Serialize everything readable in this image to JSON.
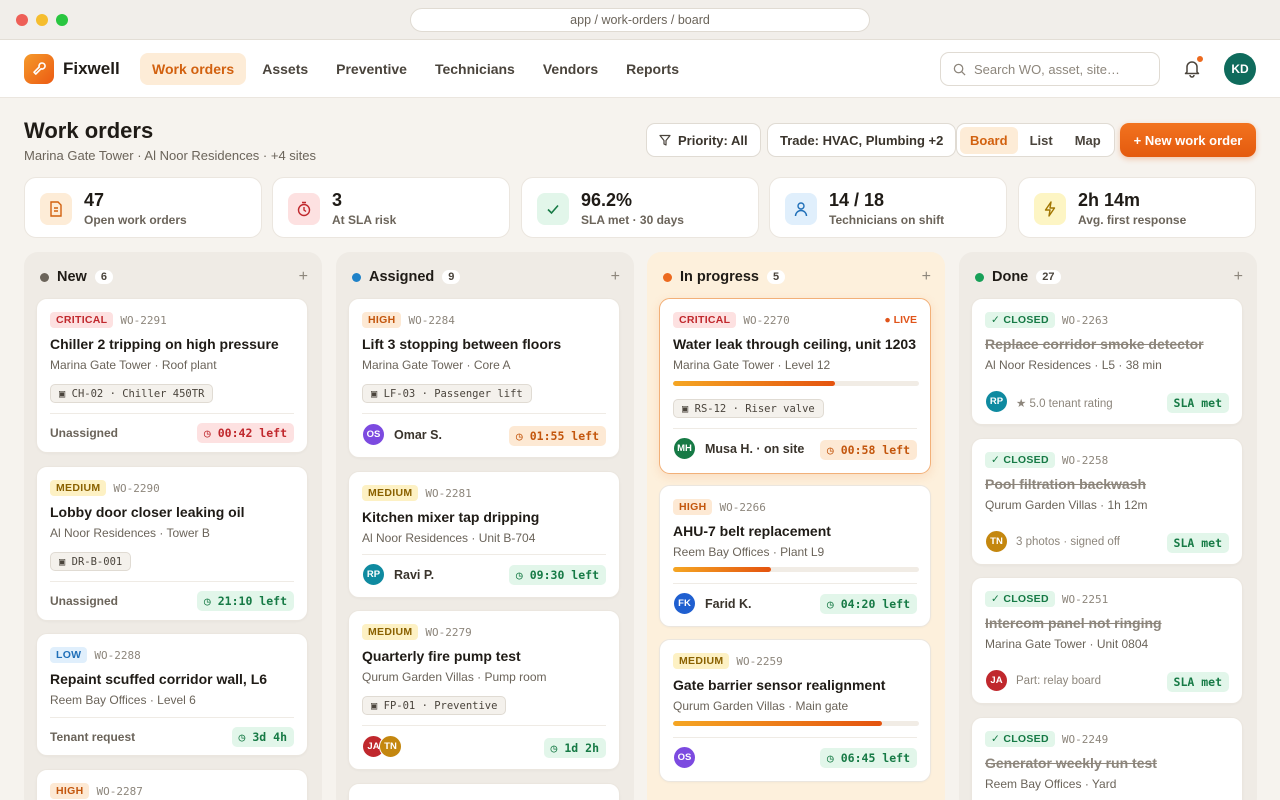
{
  "browser": {
    "url": "app / work-orders / board"
  },
  "app": {
    "brand": "Fixwell",
    "nav": [
      "Work orders",
      "Assets",
      "Preventive",
      "Technicians",
      "Vendors",
      "Reports"
    ],
    "search_placeholder": "Search WO, asset, site…",
    "user_initials": "KD"
  },
  "page": {
    "title": "Work orders",
    "subtitle": "Marina Gate Tower · Al Noor Residences · +4 sites",
    "filter_priority": "Priority: All",
    "filter_trade": "Trade: HVAC, Plumbing +2",
    "views": [
      "Board",
      "List",
      "Map"
    ],
    "active_view": "Board",
    "new_button": "+ New work order"
  },
  "colors": {
    "accent": "#ec6a1f",
    "critical": "#c0282d",
    "success": "#167a45"
  },
  "stats": [
    {
      "value": "47",
      "label": "Open work orders",
      "icon": "document-icon"
    },
    {
      "value": "3",
      "label": "At SLA risk",
      "icon": "stopwatch-icon"
    },
    {
      "value": "96.2%",
      "label": "SLA met · 30 days",
      "icon": "check-icon"
    },
    {
      "value": "14 / 18",
      "label": "Technicians on shift",
      "icon": "person-icon"
    },
    {
      "value": "2h 14m",
      "label": "Avg. first response",
      "icon": "lightning-icon"
    }
  ],
  "columns": [
    {
      "title": "New",
      "count": "6",
      "cards": [
        {
          "priority": "CRITICAL",
          "wo": "WO-2291",
          "title": "Chiller 2 tripping on high pressure",
          "location": "Marina Gate Tower · Roof plant",
          "asset": "▣ CH-02 · Chiller 450TR",
          "assignee": "Unassigned",
          "sla": "◷ 00:42 left"
        },
        {
          "priority": "MEDIUM",
          "wo": "WO-2290",
          "title": "Lobby door closer leaking oil",
          "location": "Al Noor Residences · Tower B",
          "asset": "▣ DR-B-001",
          "assignee": "Unassigned",
          "sla": "◷ 21:10 left"
        },
        {
          "priority": "LOW",
          "wo": "WO-2288",
          "title": "Repaint scuffed corridor wall, L6",
          "location": "Reem Bay Offices · Level 6",
          "assignee": "Tenant request",
          "sla": "◷ 3d 4h"
        },
        {
          "priority": "HIGH",
          "wo": "WO-2287"
        }
      ]
    },
    {
      "title": "Assigned",
      "count": "9",
      "cards": [
        {
          "priority": "HIGH",
          "wo": "WO-2284",
          "title": "Lift 3 stopping between floors",
          "location": "Marina Gate Tower · Core A",
          "asset": "▣ LF-03 · Passenger lift",
          "initials": "OS",
          "name": "Omar S.",
          "sla": "◷ 01:55 left"
        },
        {
          "priority": "MEDIUM",
          "wo": "WO-2281",
          "title": "Kitchen mixer tap dripping",
          "location": "Al Noor Residences · Unit B-704",
          "initials": "RP",
          "name": "Ravi P.",
          "sla": "◷ 09:30 left"
        },
        {
          "priority": "MEDIUM",
          "wo": "WO-2279",
          "title": "Quarterly fire pump test",
          "location": "Qurum Garden Villas · Pump room",
          "asset": "▣ FP-01 · Preventive",
          "initials": "JA",
          "initials2": "TN",
          "sla": "◷ 1d 2h"
        }
      ]
    },
    {
      "title": "In progress",
      "count": "5",
      "cards": [
        {
          "priority": "CRITICAL",
          "wo": "WO-2270",
          "live": "● LIVE",
          "title": "Water leak through ceiling, unit 1203",
          "location": "Marina Gate Tower · Level 12",
          "progress": 0.66,
          "asset": "▣ RS-12 · Riser valve",
          "initials": "MH",
          "name": "Musa H. · on site",
          "sla": "◷ 00:58 left"
        },
        {
          "priority": "HIGH",
          "wo": "WO-2266",
          "title": "AHU-7 belt replacement",
          "location": "Reem Bay Offices · Plant L9",
          "progress": 0.4,
          "initials": "FK",
          "name": "Farid K.",
          "sla": "◷ 04:20 left"
        },
        {
          "priority": "MEDIUM",
          "wo": "WO-2259",
          "title": "Gate barrier sensor realignment",
          "location": "Qurum Garden Villas · Main gate",
          "progress": 0.85,
          "initials": "OS",
          "sla": "◷ 06:45 left"
        }
      ]
    },
    {
      "title": "Done",
      "count": "27",
      "cards": [
        {
          "priority": "✓ CLOSED",
          "wo": "WO-2263",
          "title": "Replace corridor smoke detector",
          "location": "Al Noor Residences · L5 · 38 min",
          "initials": "RP",
          "meta": "★ 5.0 tenant rating",
          "sla": "SLA met"
        },
        {
          "priority": "✓ CLOSED",
          "wo": "WO-2258",
          "title": "Pool filtration backwash",
          "location": "Qurum Garden Villas · 1h 12m",
          "initials": "TN",
          "meta": "3 photos · signed off",
          "sla": "SLA met"
        },
        {
          "priority": "✓ CLOSED",
          "wo": "WO-2251",
          "title": "Intercom panel not ringing",
          "location": "Marina Gate Tower · Unit 0804",
          "initials": "JA",
          "meta": "Part: relay board",
          "sla": "SLA met"
        },
        {
          "priority": "✓ CLOSED",
          "wo": "WO-2249",
          "title": "Generator weekly run test",
          "location": "Reem Bay Offices · Yard"
        }
      ]
    }
  ]
}
